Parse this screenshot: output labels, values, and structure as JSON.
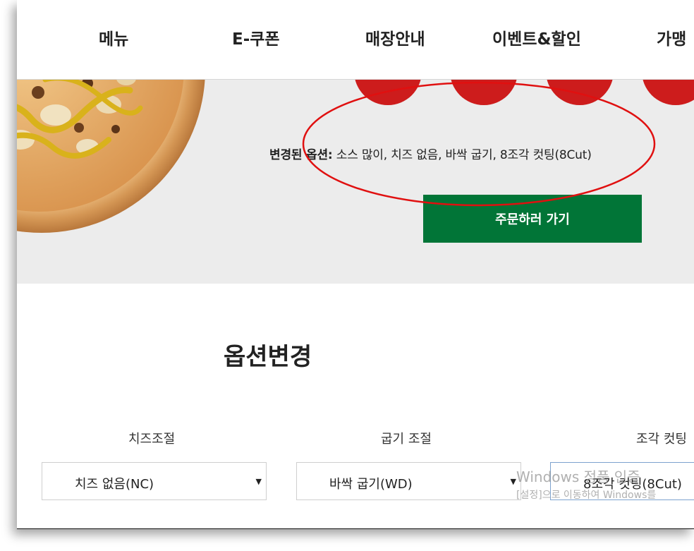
{
  "nav": {
    "items": [
      {
        "label": "메뉴"
      },
      {
        "label": "E-쿠폰"
      },
      {
        "label": "매장안내"
      },
      {
        "label": "이벤트&할인"
      },
      {
        "label": "가맹"
      }
    ]
  },
  "hero": {
    "options_label": "변경된 옵션:",
    "options_value": "소스 많이, 치즈 없음, 바싹 굽기, 8조각 컷팅(8Cut)",
    "order_button": "주문하러 가기"
  },
  "options": {
    "title": "옵션변경",
    "cheese": {
      "label": "치즈조절",
      "selected": "치즈 없음(NC)"
    },
    "bake": {
      "label": "굽기 조절",
      "selected": "바싹 굽기(WD)"
    },
    "cut": {
      "label": "조각 컷팅",
      "selected": "8조각 컷팅(8Cut)"
    }
  },
  "watermark": {
    "line1": "Windows 정품 인증",
    "line2": "[설정]으로 이동하여 Windows를"
  },
  "colors": {
    "accent_red": "#cd1c1c",
    "order_green": "#017537",
    "hero_bg": "#ececec",
    "annotation_red": "#e01010"
  },
  "icons": {
    "select_arrow": "dropdown-arrow-icon"
  }
}
